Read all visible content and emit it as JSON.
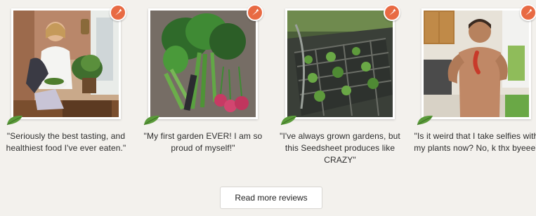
{
  "reviews": [
    {
      "quote": "\"Seriously the best tasting, and healthiest food I've ever eaten.\"",
      "photo_icon": "woman-with-salad-photo"
    },
    {
      "quote": "\"My first garden EVER! I am so proud of myself!\"",
      "photo_icon": "harvested-vegetables-photo"
    },
    {
      "quote": "\"I've always grown gardens, but this Seedsheet produces like CRAZY\"",
      "photo_icon": "garden-bed-photo"
    },
    {
      "quote": "\"Is it weird that I take selfies with my plants now? No, k thx byeee\"",
      "photo_icon": "man-with-pepper-photo"
    }
  ],
  "badge_icon": "carrot-badge-icon",
  "leaf_icon": "leaf-icon",
  "read_more_label": "Read more reviews",
  "colors": {
    "background": "#f3f1ed",
    "badge": "#e86a43",
    "leaf": "#5a9a3a"
  }
}
